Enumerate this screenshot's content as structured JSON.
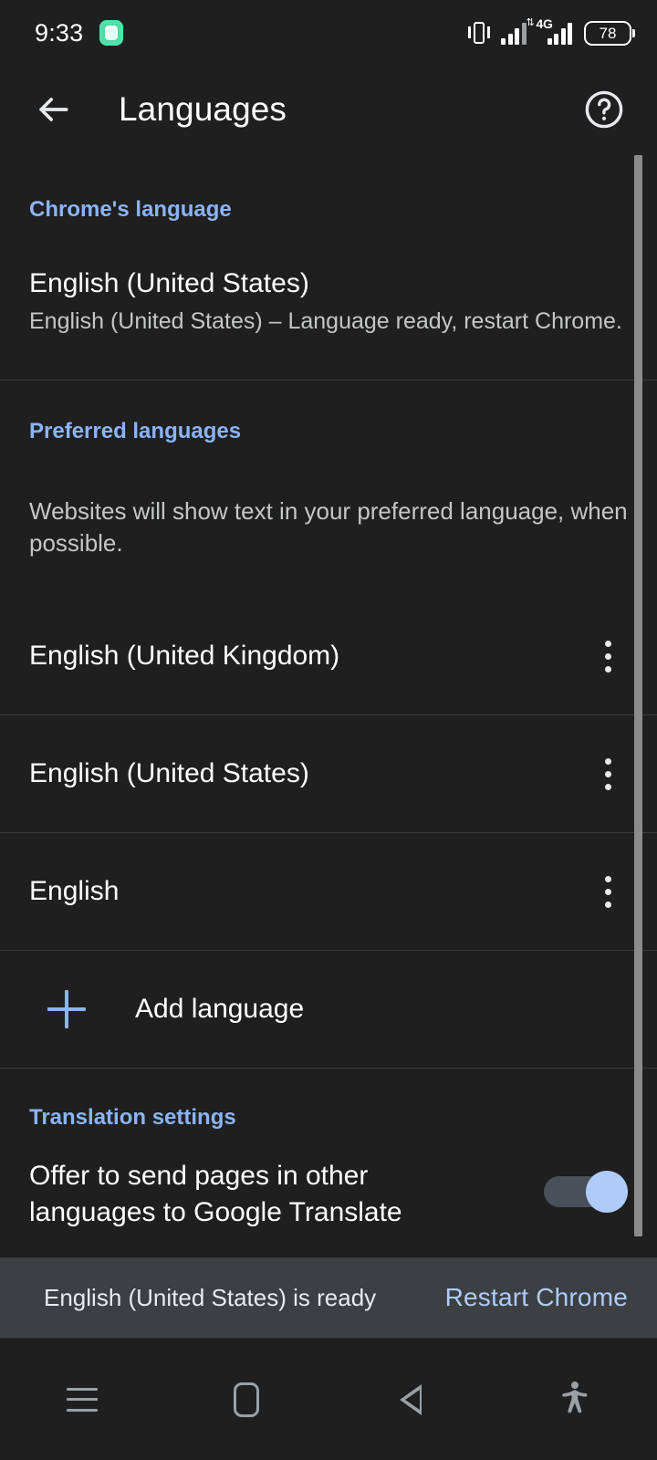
{
  "status_bar": {
    "time": "9:33",
    "notification_icon": "app-indicator-icon",
    "vibrate_icon": "vibrate-icon",
    "signal_icon": "signal-bars-icon",
    "network_type": "4G",
    "battery_level": "78"
  },
  "app_bar": {
    "back_icon": "back-arrow-icon",
    "title": "Languages",
    "help_icon": "help-circle-icon"
  },
  "sections": {
    "chrome_language": {
      "header": "Chrome's language",
      "item_title": "English (United States)",
      "item_subtitle": "English (United States) – Language ready, restart Chrome."
    },
    "preferred_languages": {
      "header": "Preferred languages",
      "description": "Websites will show text in your preferred language, when possible.",
      "items": [
        {
          "label": "English (United Kingdom)",
          "menu_icon": "more-vert-icon"
        },
        {
          "label": "English (United States)",
          "menu_icon": "more-vert-icon"
        },
        {
          "label": "English",
          "menu_icon": "more-vert-icon"
        }
      ],
      "add_label": "Add language",
      "add_icon": "plus-icon"
    },
    "translation_settings": {
      "header": "Translation settings",
      "toggle_label": "Offer to send pages in other languages to Google Translate",
      "toggle_state": "on"
    }
  },
  "snackbar": {
    "message": "English (United States) is ready",
    "action": "Restart Chrome"
  },
  "nav_bar": {
    "recents_icon": "recents-icon",
    "home_icon": "home-icon",
    "back_icon": "back-triangle-icon",
    "accessibility_icon": "accessibility-icon"
  },
  "colors": {
    "background": "#1f1f1f",
    "accent": "#8ab4f8",
    "snackbar_bg": "#3c4043",
    "toggle_thumb": "#aecbfa"
  }
}
